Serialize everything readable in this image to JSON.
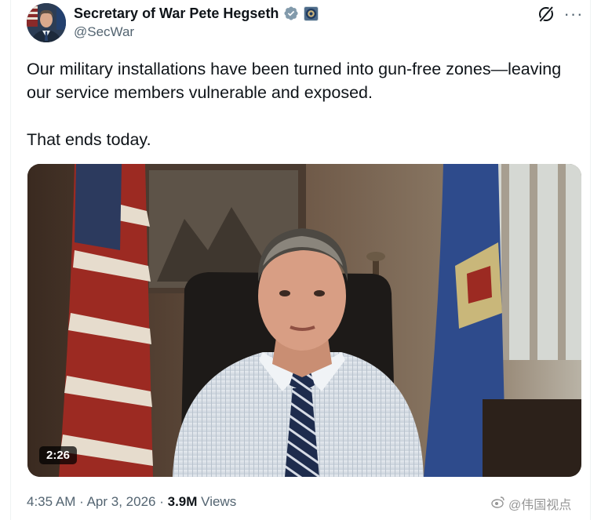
{
  "author": {
    "name": "Secretary of War Pete Hegseth",
    "handle": "@SecWar",
    "verified_badge_color": "#829aab"
  },
  "header_actions": {
    "grok_icon": "grok-slash-icon",
    "more_label": "···"
  },
  "tweet": {
    "line1": "Our military installations have been turned into gun-free zones—leaving",
    "line2": "our service members vulnerable and exposed.",
    "line3": "That ends today."
  },
  "media": {
    "duration": "2:26"
  },
  "meta": {
    "time": "4:35 AM",
    "sep1": "·",
    "date": "Apr 3, 2026",
    "sep2": "·",
    "views_count": "3.9M",
    "views_label": "Views"
  },
  "watermark": {
    "text": "@伟国视点"
  },
  "colors": {
    "text_primary": "#0f1419",
    "text_secondary": "#536471",
    "border": "#eff3f4"
  }
}
